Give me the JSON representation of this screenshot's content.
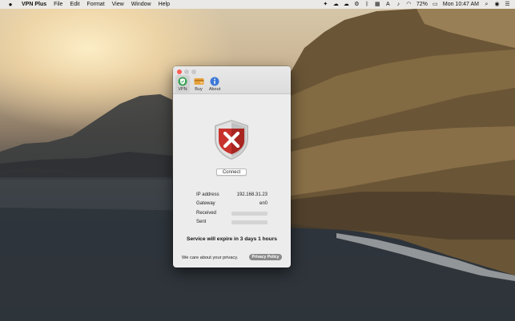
{
  "menubar": {
    "app_name": "VPN Plus",
    "menus": [
      "File",
      "Edit",
      "Format",
      "View",
      "Window",
      "Help"
    ],
    "battery": "72%",
    "clock": "Mon 10:47 AM"
  },
  "window": {
    "toolbar": [
      {
        "label": "VPN"
      },
      {
        "label": "Buy"
      },
      {
        "label": "About"
      }
    ],
    "connect_label": "Connect",
    "info": {
      "ip_label": "IP address",
      "ip_value": "192.168.31.23",
      "gateway_label": "Gateway",
      "gateway_value": "en0",
      "received_label": "Received",
      "sent_label": "Sent"
    },
    "expire_text": "Service will expire in 3 days 1 hours",
    "privacy_text": "We care about your privacy.",
    "privacy_button": "Privacy Policy"
  },
  "colors": {
    "shield_red": "#c8312c",
    "close_red": "#fd5c56",
    "vpn_green": "#3aa356",
    "about_blue": "#3d78d8"
  }
}
